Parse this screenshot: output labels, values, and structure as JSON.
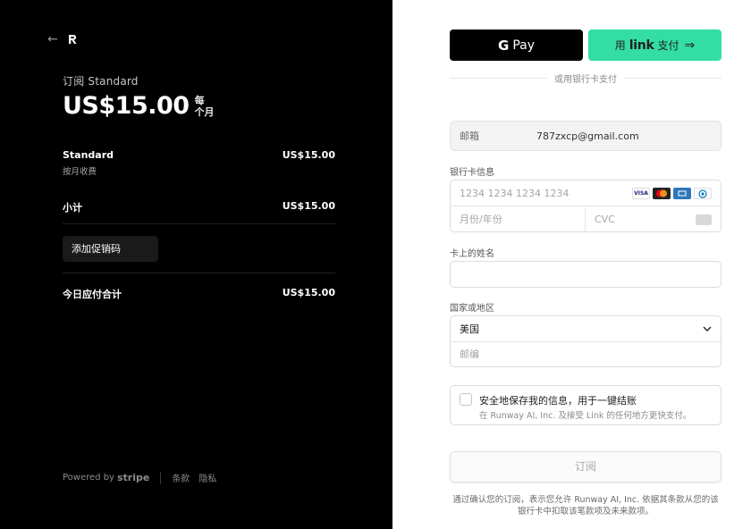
{
  "summary": {
    "plan_label": "订阅 Standard",
    "price": "US$15.00",
    "per_line1": "每",
    "per_line2": "个月",
    "item_name": "Standard",
    "item_price": "US$15.00",
    "item_billing": "按月收费",
    "subtotal_label": "小计",
    "subtotal_value": "US$15.00",
    "promo_label": "添加促销码",
    "total_label": "今日应付合计",
    "total_value": "US$15.00"
  },
  "footer": {
    "powered_by": "Powered by",
    "stripe": "stripe",
    "terms": "条款",
    "privacy": "隐私"
  },
  "payment": {
    "gpay_g": "G",
    "gpay_label": "Pay",
    "link_prefix": "用",
    "link_brand": "link",
    "link_suffix": "支付",
    "or_card": "或用银行卡支付",
    "email_label": "邮箱",
    "email_value": "787zxcp@gmail.com",
    "card_info_label": "银行卡信息",
    "card_number_placeholder": "1234 1234 1234 1234",
    "card_brands": [
      "VISA",
      "MC",
      "AMEX",
      "DC"
    ],
    "expiry_placeholder": "月份/年份",
    "cvc_placeholder": "CVC",
    "name_label": "卡上的姓名",
    "country_label": "国家或地区",
    "country_value": "美国",
    "zip_placeholder": "邮编",
    "save_title": "安全地保存我的信息，用于一键结账",
    "save_desc": "在 Runway AI, Inc. 及接受 Link 的任何地方更快支付。",
    "subscribe_label": "订阅",
    "legal_text": "通过确认您的订阅，表示您允许 Runway AI, Inc. 依据其条款从您的该银行卡中扣取该笔款项及未来款项。"
  },
  "colors": {
    "left_bg": "#000000",
    "link_green": "#33dda4"
  }
}
